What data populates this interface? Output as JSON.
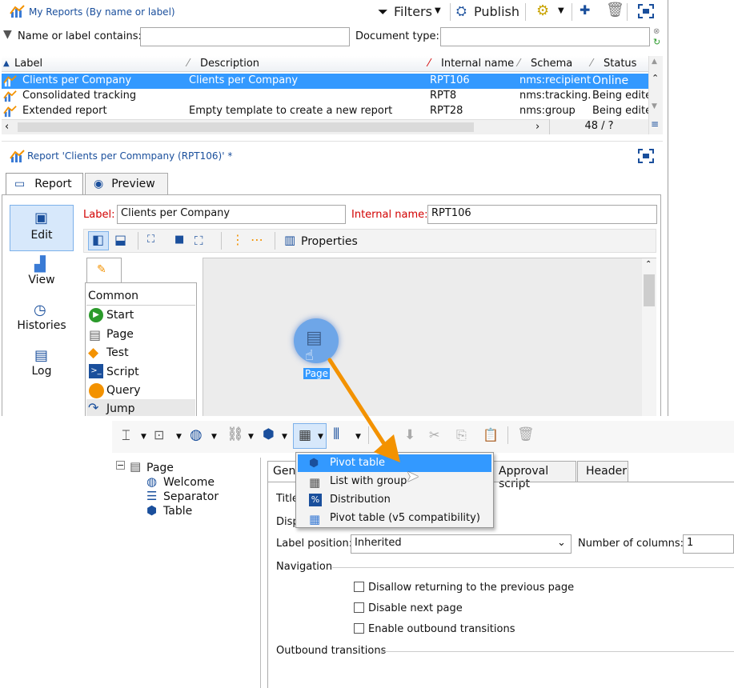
{
  "top": {
    "title": "My Reports (By name or label)",
    "filters_label": "Filters",
    "publish_label": "Publish",
    "filter_name_label": "Name or label contains:",
    "filter_doc_label": "Document type:",
    "filter_name_value": "",
    "filter_doc_value": ""
  },
  "grid": {
    "columns": [
      "Label",
      "Description",
      "Internal name",
      "Schema",
      "Status"
    ],
    "rows": [
      {
        "label": "Clients per Company",
        "description": "Clients per Company",
        "internal": "RPT106",
        "schema": "nms:recipient",
        "status": "Online"
      },
      {
        "label": "Consolidated tracking",
        "description": "",
        "internal": "RPT8",
        "schema": "nms:tracking...",
        "status": "Being edite"
      },
      {
        "label": "Extended report",
        "description": "Empty template to create a new report",
        "internal": "RPT28",
        "schema": "nms:group",
        "status": "Being edite"
      }
    ],
    "count": "48 / ?"
  },
  "report": {
    "title": "Report 'Clients per Commpany (RPT106)' *",
    "tabs": [
      "Report",
      "Preview"
    ],
    "side": [
      "Edit",
      "View",
      "Histories",
      "Log"
    ],
    "label_caption": "Label:",
    "label_value": "Clients per Company",
    "internal_caption": "Internal name:",
    "internal_value": "RPT106",
    "properties_label": "Properties",
    "palette_header": "Common",
    "palette": [
      "Start",
      "Page",
      "Test",
      "Script",
      "Query",
      "Jump"
    ],
    "canvas_node": "Page"
  },
  "bottom": {
    "tree": [
      "Page",
      "Welcome",
      "Separator",
      "Table"
    ],
    "tabs": [
      "Gen",
      "Approval script",
      "Header"
    ],
    "menu": [
      "Pivot table",
      "List with group",
      "Distribution",
      "Pivot table (v5 compatibility)"
    ],
    "title_label": "Title",
    "disp_label": "Disp",
    "label_position_caption": "Label position:",
    "label_position_value": "Inherited",
    "num_columns_caption": "Number of columns:",
    "num_columns_value": "1",
    "navigation_label": "Navigation",
    "checks": [
      "Disallow returning to the previous page",
      "Disable next page",
      "Enable outbound transitions"
    ],
    "outbound_label": "Outbound transitions"
  },
  "colors": {
    "accent": "#3399ff",
    "orange": "#f39200",
    "required": "#d20000"
  }
}
